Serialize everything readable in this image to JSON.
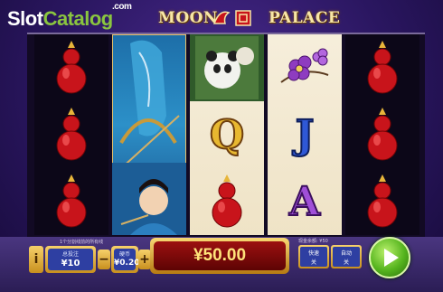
{
  "branding": {
    "watermark_slot": "Slot",
    "watermark_catalog": "Catalog",
    "watermark_com": ".com",
    "game_title_left": "MOON",
    "game_title_right": "PALACE"
  },
  "reels": {
    "symbols": [
      [
        "red-gourd",
        "red-gourd",
        "red-gourd"
      ],
      [
        "archer-warrior-stacked"
      ],
      [
        "panda",
        "Q",
        "red-gourd"
      ],
      [
        "purple-flowers",
        "J",
        "A"
      ],
      [
        "red-gourd",
        "red-gourd",
        "red-gourd"
      ]
    ],
    "letters": {
      "q": "Q",
      "j": "J",
      "a": "A"
    }
  },
  "controls": {
    "info_label": "i",
    "total_bet_label": "总投注",
    "total_bet_value": "¥10",
    "coin_label": "硬币",
    "coin_value": "¥0.20",
    "decrease_label": "−",
    "increase_label": "+",
    "lines_note": "1个分割线前的所有线",
    "win_value": "¥50.00",
    "balance_note": "现金余额: ¥50",
    "fast_label": "快速",
    "fast_value": "关",
    "auto_label": "自动",
    "auto_value": "关"
  },
  "colors": {
    "gourd_red": "#c8141b",
    "gourd_gold": "#e7b53a",
    "reel_light": "#f6eedb",
    "spin_green": "#55b41e",
    "win_text": "#ffe37a"
  }
}
